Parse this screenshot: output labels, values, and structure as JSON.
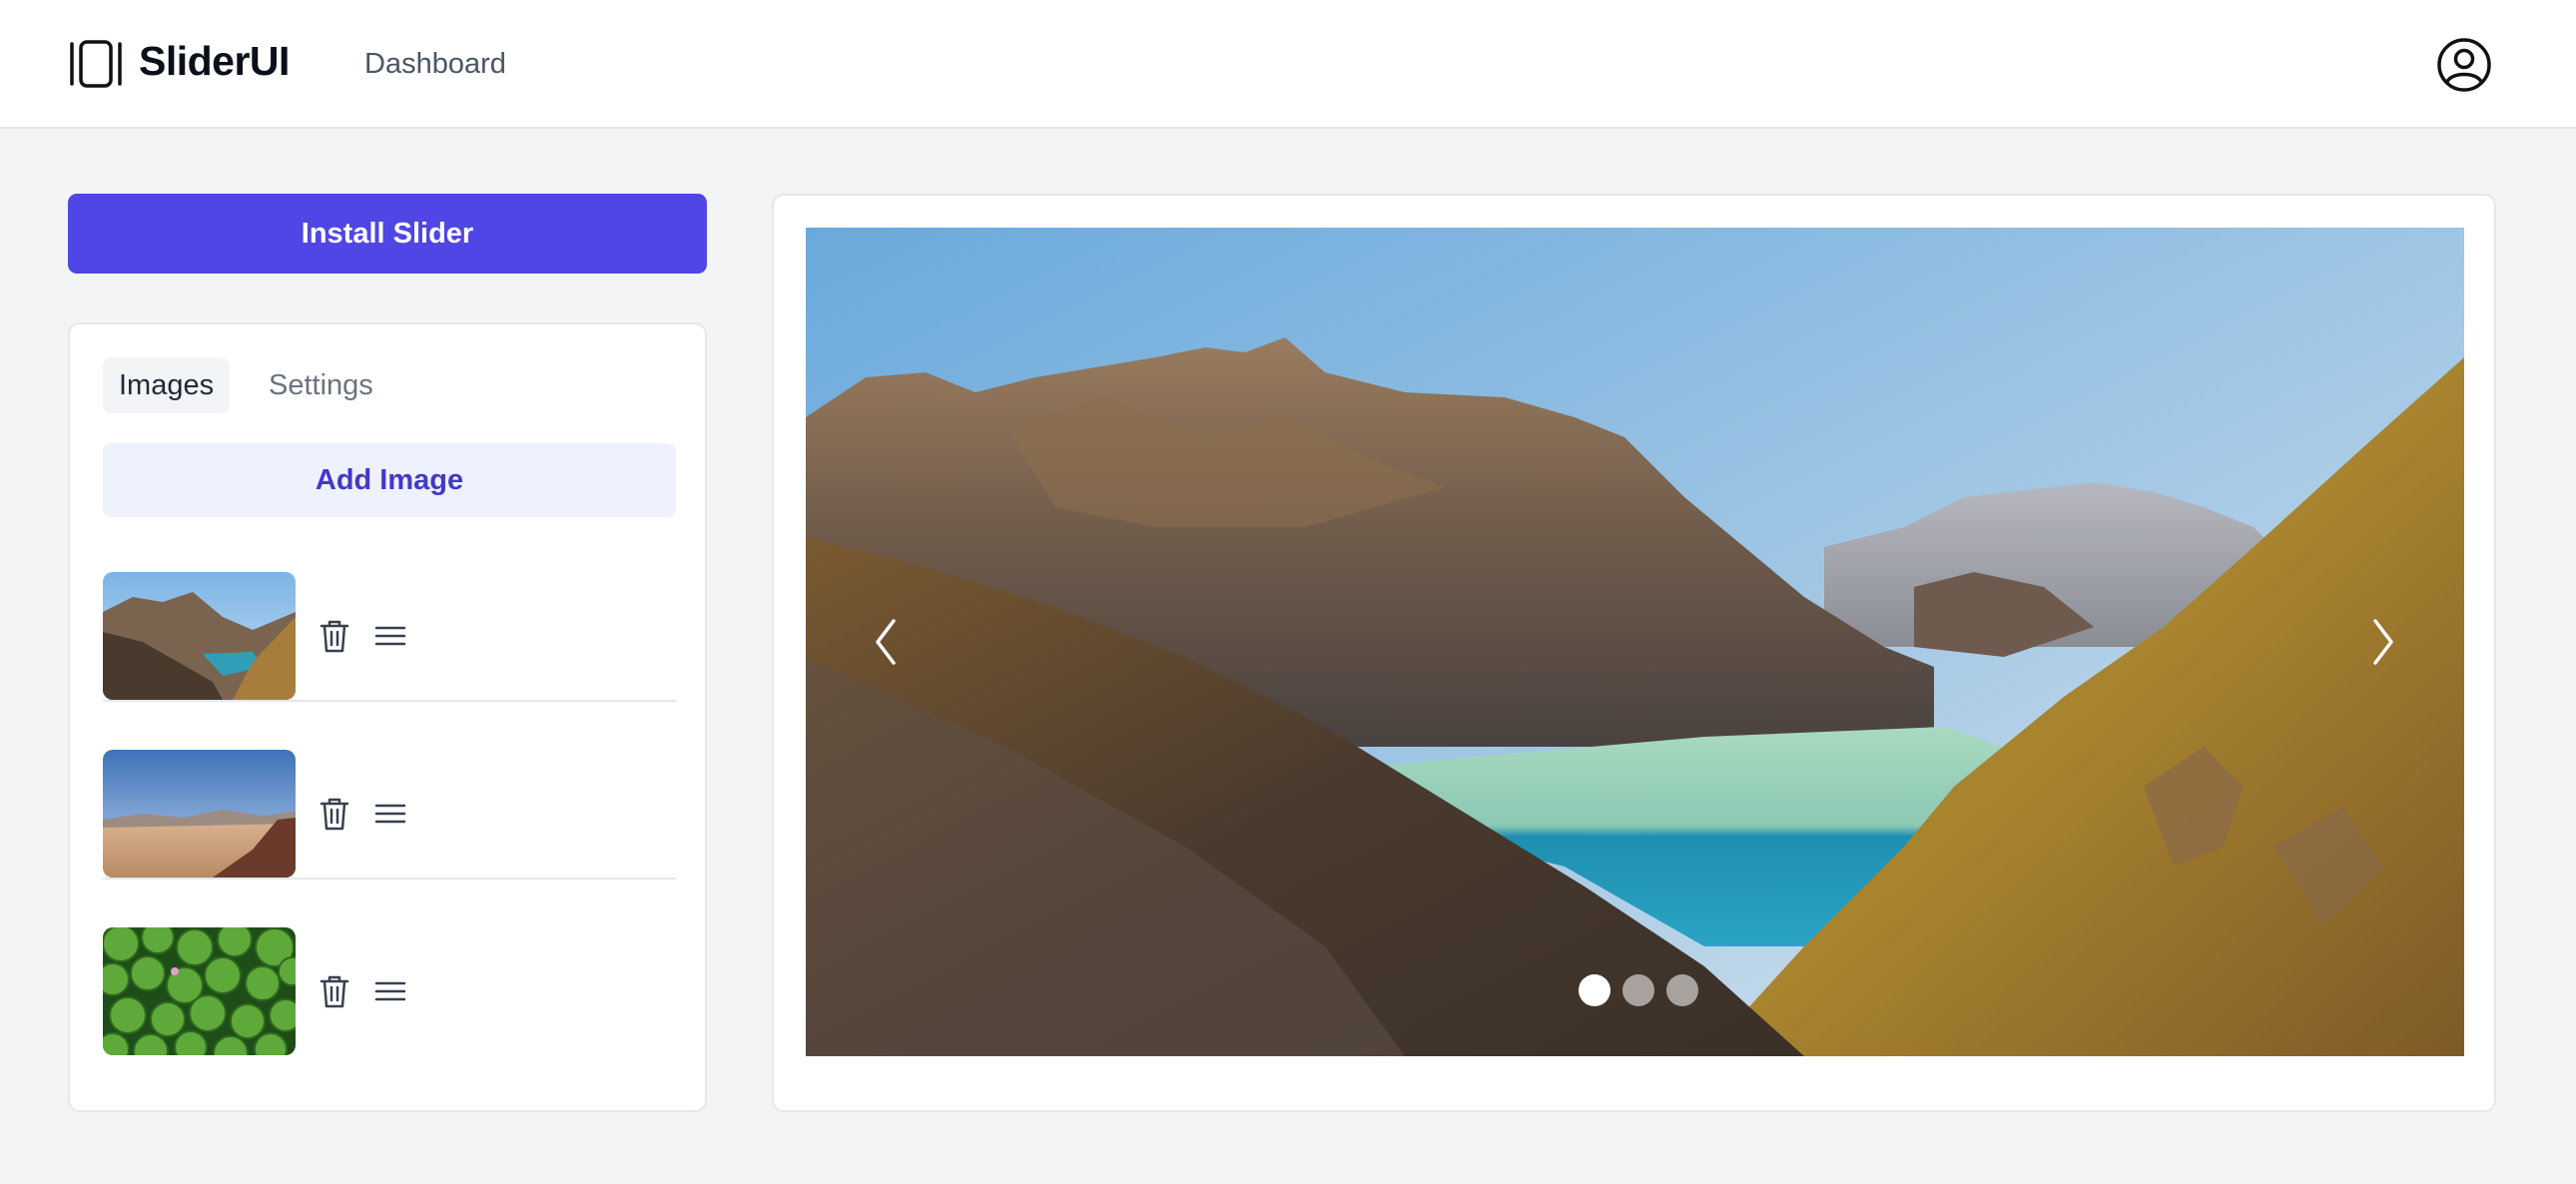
{
  "app": {
    "brand": "SliderUI",
    "nav": {
      "dashboard_label": "Dashboard"
    }
  },
  "sidebar": {
    "install_label": "Install Slider",
    "tabs": [
      {
        "label": "Images",
        "active": true
      },
      {
        "label": "Settings",
        "active": false
      }
    ],
    "add_image_label": "Add Image",
    "images": [
      {
        "thumbnail": "alpine-lake-valley"
      },
      {
        "thumbnail": "desert-mountains"
      },
      {
        "thumbnail": "green-lily-pads"
      }
    ]
  },
  "slider": {
    "current_slide": 1,
    "slide_count": 3,
    "current_image": "alpine-lake-valley"
  },
  "colors": {
    "primary": "#4f46e5",
    "primary_light": "#eef2ff",
    "primary_text": "#4338ca",
    "background": "#f3f4f6",
    "border": "#e5e7eb"
  },
  "icons": {
    "logo": "slider-logo-icon",
    "profile": "user-circle-icon",
    "trash": "trash-icon",
    "drag": "drag-handle-icon",
    "prev": "chevron-left-icon",
    "next": "chevron-right-icon"
  }
}
